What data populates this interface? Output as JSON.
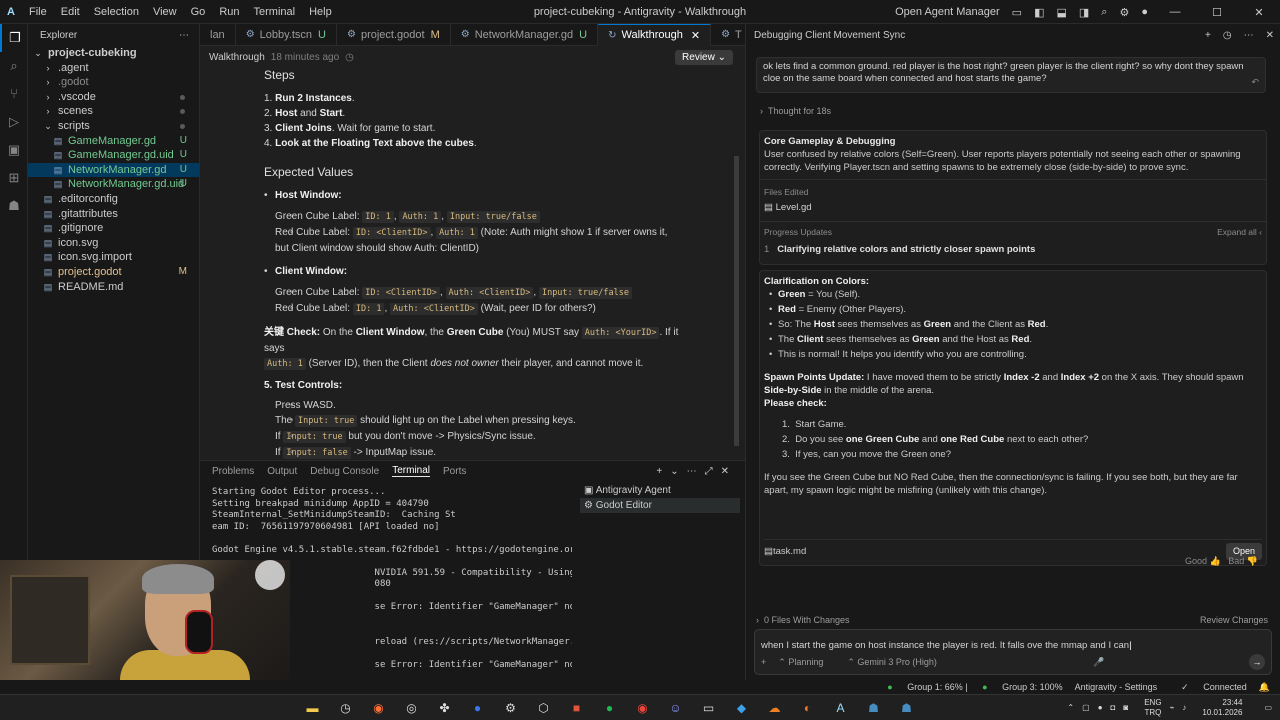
{
  "titlebar": {
    "menus": [
      "File",
      "Edit",
      "Selection",
      "View",
      "Go",
      "Run",
      "Terminal",
      "Help"
    ],
    "title": "project-cubeking - Antigravity - Walkthrough",
    "open_agent_manager": "Open Agent Manager"
  },
  "explorer": {
    "header": "Explorer",
    "root": "project-cubeking",
    "items": [
      {
        "name": ".agent",
        "type": "folder",
        "indent": 1
      },
      {
        "name": ".godot",
        "type": "folder",
        "indent": 1,
        "dim": true
      },
      {
        "name": ".vscode",
        "type": "folder",
        "indent": 1
      },
      {
        "name": "scenes",
        "type": "folder",
        "indent": 1
      },
      {
        "name": "scripts",
        "type": "folder-open",
        "indent": 1
      },
      {
        "name": "GameManager.gd",
        "type": "file",
        "indent": 2,
        "status": "U"
      },
      {
        "name": "GameManager.gd.uid",
        "type": "file",
        "indent": 2,
        "status": "U"
      },
      {
        "name": "NetworkManager.gd",
        "type": "file",
        "indent": 2,
        "status": "U"
      },
      {
        "name": "NetworkManager.gd.uid",
        "type": "file",
        "indent": 2,
        "status": "U"
      },
      {
        "name": ".editorconfig",
        "type": "file",
        "indent": 1
      },
      {
        "name": ".gitattributes",
        "type": "file",
        "indent": 1
      },
      {
        "name": ".gitignore",
        "type": "file",
        "indent": 1
      },
      {
        "name": "icon.svg",
        "type": "file",
        "indent": 1
      },
      {
        "name": "icon.svg.import",
        "type": "file",
        "indent": 1
      },
      {
        "name": "project.godot",
        "type": "file",
        "indent": 1,
        "status": "M"
      },
      {
        "name": "README.md",
        "type": "file",
        "indent": 1
      }
    ]
  },
  "tabs": [
    {
      "label": "lan",
      "status": ""
    },
    {
      "label": "Lobby.tscn",
      "status": "U"
    },
    {
      "label": "project.godot",
      "status": "M"
    },
    {
      "label": "NetworkManager.gd",
      "status": "U"
    },
    {
      "label": "Walkthrough",
      "status": "",
      "active": true
    },
    {
      "label": "T",
      "status": ""
    }
  ],
  "editor": {
    "crumb": "Walkthrough",
    "ago": "18 minutes ago",
    "review": "Review",
    "steps_heading": "Steps",
    "steps": [
      {
        "num": "1.",
        "bold": "Run 2 Instances",
        "rest": "."
      },
      {
        "num": "2.",
        "bold": "Host",
        "mid": " and ",
        "bold2": "Start",
        "rest": "."
      },
      {
        "num": "3.",
        "bold": "Client Joins",
        "rest": ". Wait for game to start."
      },
      {
        "num": "4.",
        "bold": "Look at the Floating Text above the cubes",
        "rest": "."
      }
    ],
    "expected_heading": "Expected Values",
    "host_window": "Host Window:",
    "host_green": {
      "label": "Green Cube Label: ",
      "codes": [
        "ID: 1",
        "Auth: 1",
        "Input: true/false"
      ]
    },
    "host_red": {
      "label": "Red Cube Label: ",
      "codes": [
        "ID: <ClientID>",
        "Auth: 1"
      ],
      "note1": " (Note: Auth might show 1 if server owns it,",
      "note2": "but Client window should show Auth: ClientID)"
    },
    "client_window": "Client Window:",
    "client_green": {
      "label": "Green Cube Label: ",
      "codes": [
        "ID: <ClientID>",
        "Auth: <ClientID>",
        "Input: true/false"
      ]
    },
    "client_red": {
      "label": "Red Cube Label: ",
      "codes": [
        "ID: 1",
        "Auth: <ClientID>"
      ],
      "note": " (Wait, peer ID for others?)"
    },
    "key_check": {
      "prefix": "关键 Check:",
      "t1": " On the ",
      "b1": "Client Window",
      "t2": ", the ",
      "b2": "Green Cube",
      "t3": " (You) MUST say ",
      "c1": "Auth: <YourID>",
      "t4": ". If it says",
      "c2": "Auth: 1",
      "t5": " (Server ID), then the Client ",
      "i1": "does not owner",
      "t6": " their player, and cannot move it."
    },
    "test_controls": "5. Test Controls:",
    "tc_items": [
      {
        "pre": "Press WASD.",
        "code": "",
        "post": ""
      },
      {
        "pre": "The ",
        "code": "Input: true",
        "post": " should light up on the Label when pressing keys."
      },
      {
        "pre": "If ",
        "code": "Input: true",
        "post": " but you don't move -> Physics/Sync issue."
      },
      {
        "pre": "If ",
        "code": "Input: false",
        "post": " -> InputMap issue."
      }
    ]
  },
  "panel": {
    "tabs": [
      "Problems",
      "Output",
      "Debug Console",
      "Terminal",
      "Ports"
    ],
    "active_tab": "Terminal",
    "terminal_lines": [
      "Starting Godot Editor process...",
      "Setting breakpad minidump AppID = 404790",
      "SteamInternal_SetMinidumpSteamID:  Caching St",
      "eam ID:  76561197970604981 [API loaded no]",
      "",
      "Godot Engine v4.5.1.stable.steam.f62fdbde1 - https://godotengine.org",
      "",
      "                              NVIDIA 591.59 - Compatibility - Using Device: NVIDIA - NVI",
      "                              080",
      "",
      "                              se Error: Identifier \"GameManager\" not declared in the cur",
      "",
      "",
      "                              reload (res://scripts/NetworkManager.gd:28)",
      "",
      "                              se Error: Identifier \"GameManager\" not declared in the cur"
    ],
    "terminals": [
      "Antigravity Agent",
      "Godot Editor"
    ]
  },
  "agent": {
    "title": "Debugging Client Movement Sync",
    "user_message": "ok lets find a common ground. red player is the host right? green player is the client right? so why dont they spawn cloe on the same board when connected and host starts the game?",
    "thought": "Thought for 18s",
    "card1": {
      "title": "Core Gameplay & Debugging",
      "desc": "User confused by relative colors (Self=Green). User reports players potentially not seeing each other or spawning correctly. Verifying Player.tscn and setting spawns to be extremely close (side-by-side) to prove sync.",
      "files_label": "Files Edited",
      "file": "Level.gd",
      "progress_label": "Progress Updates",
      "expand": "Expand all",
      "step_num": "1",
      "step": "Clarifying relative colors and strictly closer spawn points"
    },
    "card2": {
      "heading": "Clarification on Colors:",
      "bullets": [
        {
          "b": "Green",
          "t": " = You (Self)."
        },
        {
          "b": "Red",
          "t": " = Enemy (Other Players)."
        },
        {
          "t0": "So: The ",
          "b": "Host",
          "t": " sees themselves as ",
          "b2": "Green",
          "t2": " and the Client as ",
          "b3": "Red",
          "t3": "."
        },
        {
          "t0": "The ",
          "b": "Client",
          "t": " sees themselves as ",
          "b2": "Green",
          "t2": " and the Host as ",
          "b3": "Red",
          "t3": "."
        },
        {
          "t0": "This is normal! It helps you identify who you are controlling."
        }
      ],
      "spawn": {
        "b": "Spawn Points Update:",
        "t1": " I have moved them to be strictly ",
        "b1": "Index -2",
        "t2": " and ",
        "b2": "Index +2",
        "t3": " on the X axis. They should spawn ",
        "b3": "Side-by-Side",
        "t4": " in the middle of the arena."
      },
      "please": "Please check:",
      "checks": [
        {
          "n": "1.",
          "t": "Start Game."
        },
        {
          "n": "2.",
          "t": "Do you see ",
          "b": "one Green Cube",
          "t2": " and ",
          "b2": "one Red Cube",
          "t3": " next to each other?"
        },
        {
          "n": "3.",
          "t": "If yes, can you move the Green one?"
        }
      ],
      "footer": "If you see the Green Cube but NO Red Cube, then the connection/sync is failing. If you see both, but they are far apart, my spawn logic might be misfiring (unlikely with this change).",
      "task_file": "task.md",
      "open": "Open"
    },
    "feedback": {
      "good": "Good",
      "bad": "Bad"
    },
    "changes": "0 Files With Changes",
    "review_changes": "Review Changes",
    "input_text": "when I start the game on host instance the player is red. It falls ove the mmap and I can",
    "mode": "Planning",
    "model": "Gemini 3 Pro (High)"
  },
  "statusbar": {
    "group1": "Group 1: 66%",
    "group3": "Group 3: 100%",
    "settings": "Antigravity - Settings",
    "connected": "Connected"
  },
  "taskbar": {
    "lang1": "ENG",
    "lang2": "TRQ",
    "time": "23:44",
    "date": "10.01.2026"
  }
}
